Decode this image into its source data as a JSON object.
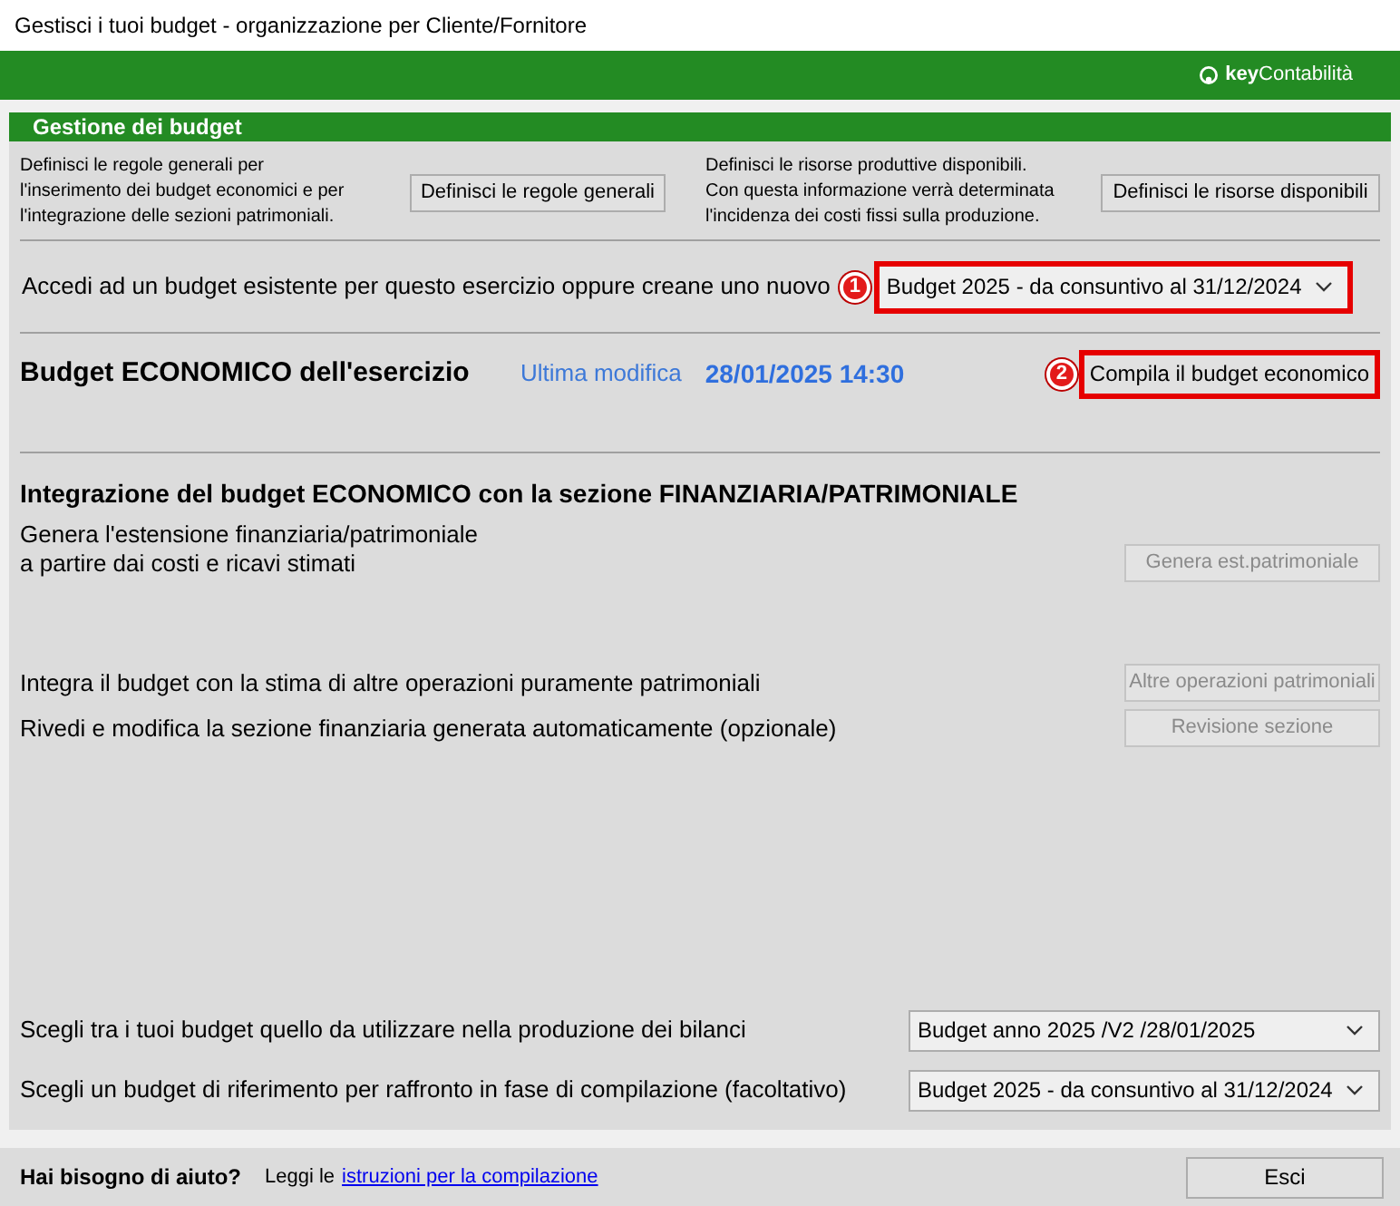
{
  "window": {
    "title": "Gestisci i tuoi budget - organizzazione per Cliente/Fornitore"
  },
  "brand": {
    "bold": "key",
    "rest": "Contabilità"
  },
  "section": {
    "title": "Gestione dei budget"
  },
  "rules": [
    {
      "description": [
        "Definisci le regole generali per",
        "l'inserimento dei budget economici e per",
        "l'integrazione delle sezioni patrimoniali."
      ],
      "button": "Definisci le regole generali",
      "disabled": false
    },
    {
      "description": [
        "Definisci le risorse produttive disponibili.",
        "Con questa informazione verrà determinata",
        "l'incidenza dei costi fissi sulla produzione."
      ],
      "button": "Definisci le risorse disponibili",
      "disabled": false
    }
  ],
  "access": {
    "label": "Accedi ad un budget esistente per questo esercizio oppure creane uno nuovo",
    "callout": "1",
    "value": "Budget 2025 - da consuntivo al 31/12/2024"
  },
  "economic": {
    "title": "Budget ECONOMICO dell'esercizio",
    "modified_label": "Ultima modifica",
    "modified_value": "28/01/2025 14:30",
    "callout": "2",
    "button": "Compila il budget economico"
  },
  "integration": {
    "title": "Integrazione del budget ECONOMICO con la sezione FINANZIARIA/PATRIMONIALE",
    "rows": [
      {
        "lines": [
          "Genera l'estensione finanziaria/patrimoniale",
          "a partire dai costi e ricavi stimati"
        ],
        "button": "Genera est.patrimoniale",
        "disabled": true
      },
      {
        "lines": [
          "Integra il budget con la stima di altre operazioni puramente patrimoniali"
        ],
        "button": "Altre operazioni patrimoniali",
        "disabled": true
      },
      {
        "lines": [
          "Rivedi e modifica la sezione finanziaria generata automaticamente (opzionale)"
        ],
        "button": "Revisione sezione",
        "disabled": true
      }
    ]
  },
  "choices": [
    {
      "label": "Scegli tra i tuoi budget quello da utilizzare nella produzione dei bilanci",
      "value": "Budget anno 2025 /V2 /28/01/2025"
    },
    {
      "label": "Scegli un budget di riferimento per raffronto in fase di compilazione (facoltativo)",
      "value": "Budget 2025 - da consuntivo al 31/12/2024"
    }
  ],
  "footer": {
    "help": "Hai bisogno di aiuto?",
    "read": "Leggi le",
    "link": "istruzioni per la compilazione",
    "close": "Esci"
  }
}
